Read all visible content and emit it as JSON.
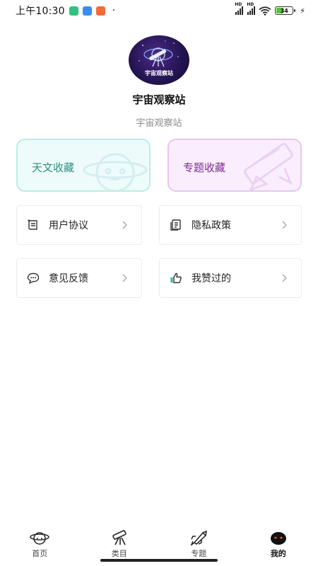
{
  "status_bar": {
    "time": "上午10:30",
    "separator": "·",
    "battery_level": "34"
  },
  "profile": {
    "avatar_text": "宇宙观察站",
    "title": "宇宙观察站",
    "subtitle": "宇宙观察站"
  },
  "collections": {
    "astronomy": {
      "label": "天文收藏",
      "icon": "planet-icon"
    },
    "topic": {
      "label": "专题收藏",
      "icon": "rocket-icon"
    }
  },
  "menu": {
    "user_agreement": {
      "label": "用户协议",
      "icon": "scroll-icon"
    },
    "privacy_policy": {
      "label": "隐私政策",
      "icon": "document-icon"
    },
    "feedback": {
      "label": "意见反馈",
      "icon": "chat-icon"
    },
    "liked": {
      "label": "我赞过的",
      "icon": "thumbs-up-icon"
    }
  },
  "bottom_nav": {
    "items": [
      {
        "label": "首页",
        "icon": "planet-icon"
      },
      {
        "label": "类目",
        "icon": "telescope-icon"
      },
      {
        "label": "专题",
        "icon": "rocket-icon"
      },
      {
        "label": "我的",
        "icon": "alien-avatar-icon"
      }
    ],
    "active_index": 3
  },
  "colors": {
    "astronomy_card_bg": "#edfcfb",
    "astronomy_card_border": "#b9ede4",
    "astronomy_text": "#2f8e7c",
    "topic_card_bg": "#faeefe",
    "topic_card_border": "#e7c5f0",
    "topic_text": "#7a2e8f",
    "battery_fill": "#58c33a"
  }
}
